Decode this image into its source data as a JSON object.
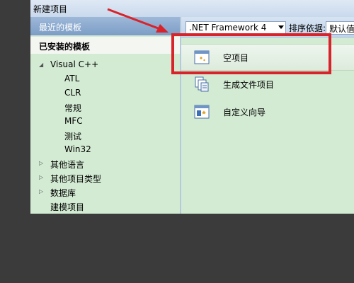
{
  "window": {
    "title": "新建项目"
  },
  "sidebar": {
    "recent_label": "最近的模板",
    "installed_label": "已安装的模板",
    "tree": [
      {
        "label": "Visual C++",
        "expanded": true
      },
      {
        "label": "ATL"
      },
      {
        "label": "CLR"
      },
      {
        "label": "常规"
      },
      {
        "label": "MFC"
      },
      {
        "label": "测试"
      },
      {
        "label": "Win32"
      },
      {
        "label": "其他语言",
        "expandable": true
      },
      {
        "label": "其他项目类型",
        "expandable": true
      },
      {
        "label": "数据库",
        "expandable": true
      },
      {
        "label": "建模项目"
      }
    ]
  },
  "toolbar": {
    "framework_value": ".NET Framework 4",
    "sort_label": "排序依据:",
    "sort_value": "默认值"
  },
  "templates": [
    {
      "label": "空项目",
      "icon": "empty-project-icon",
      "selected": true
    },
    {
      "label": "生成文件项目",
      "icon": "makefile-project-icon"
    },
    {
      "label": "自定义向导",
      "icon": "custom-wizard-icon"
    }
  ],
  "colors": {
    "panel_bg": "#d3ebd3",
    "highlight": "#d8232a",
    "header_blue": "#8badd2"
  }
}
